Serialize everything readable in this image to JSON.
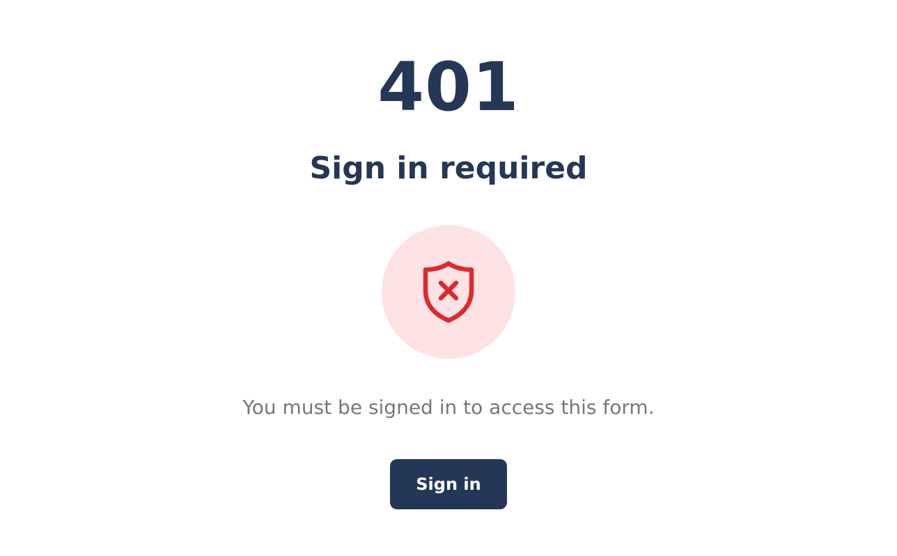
{
  "error": {
    "code": "401",
    "title": "Sign in required",
    "message": "You must be signed in to access this form."
  },
  "icon": {
    "name": "shield-x-icon"
  },
  "action": {
    "sign_in_label": "Sign in"
  },
  "colors": {
    "heading": "#243756",
    "message": "#777777",
    "icon_background": "#fde3e3",
    "icon_stroke": "#e0282f",
    "button_background": "#243756",
    "button_text": "#ffffff"
  }
}
